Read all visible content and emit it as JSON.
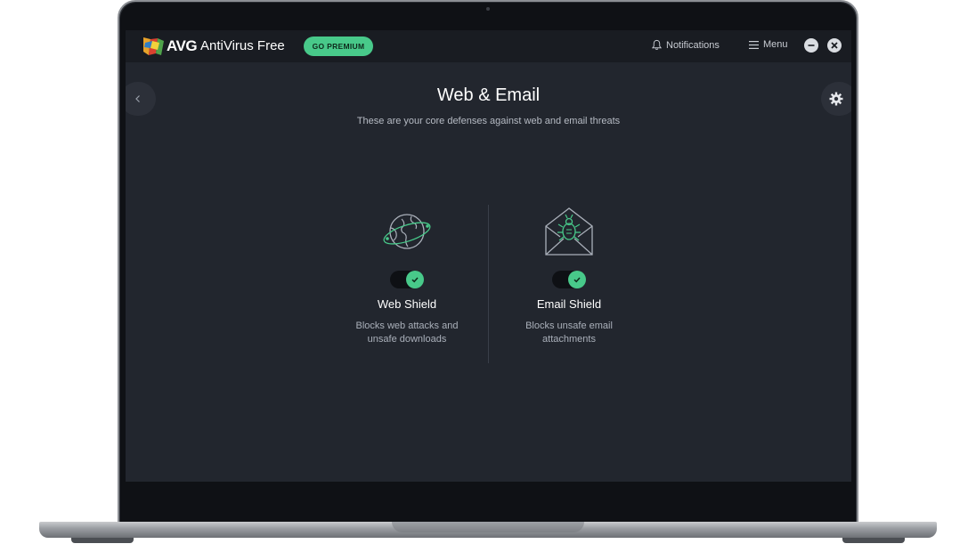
{
  "app": {
    "brand": "AVG",
    "product": "AntiVirus Free",
    "premium_label": "GO PREMIUM",
    "notifications_label": "Notifications",
    "menu_label": "Menu"
  },
  "page": {
    "title": "Web & Email",
    "subtitle": "These are your core defenses against web and email threats"
  },
  "shields": [
    {
      "name": "Web Shield",
      "description": "Blocks web attacks and unsafe downloads",
      "icon": "globe-icon",
      "enabled": true
    },
    {
      "name": "Email Shield",
      "description": "Blocks unsafe email attachments",
      "icon": "envelope-bug-icon",
      "enabled": true
    }
  ],
  "colors": {
    "accent": "#48c98a",
    "background": "#22262e",
    "titlebar": "#191c22"
  }
}
